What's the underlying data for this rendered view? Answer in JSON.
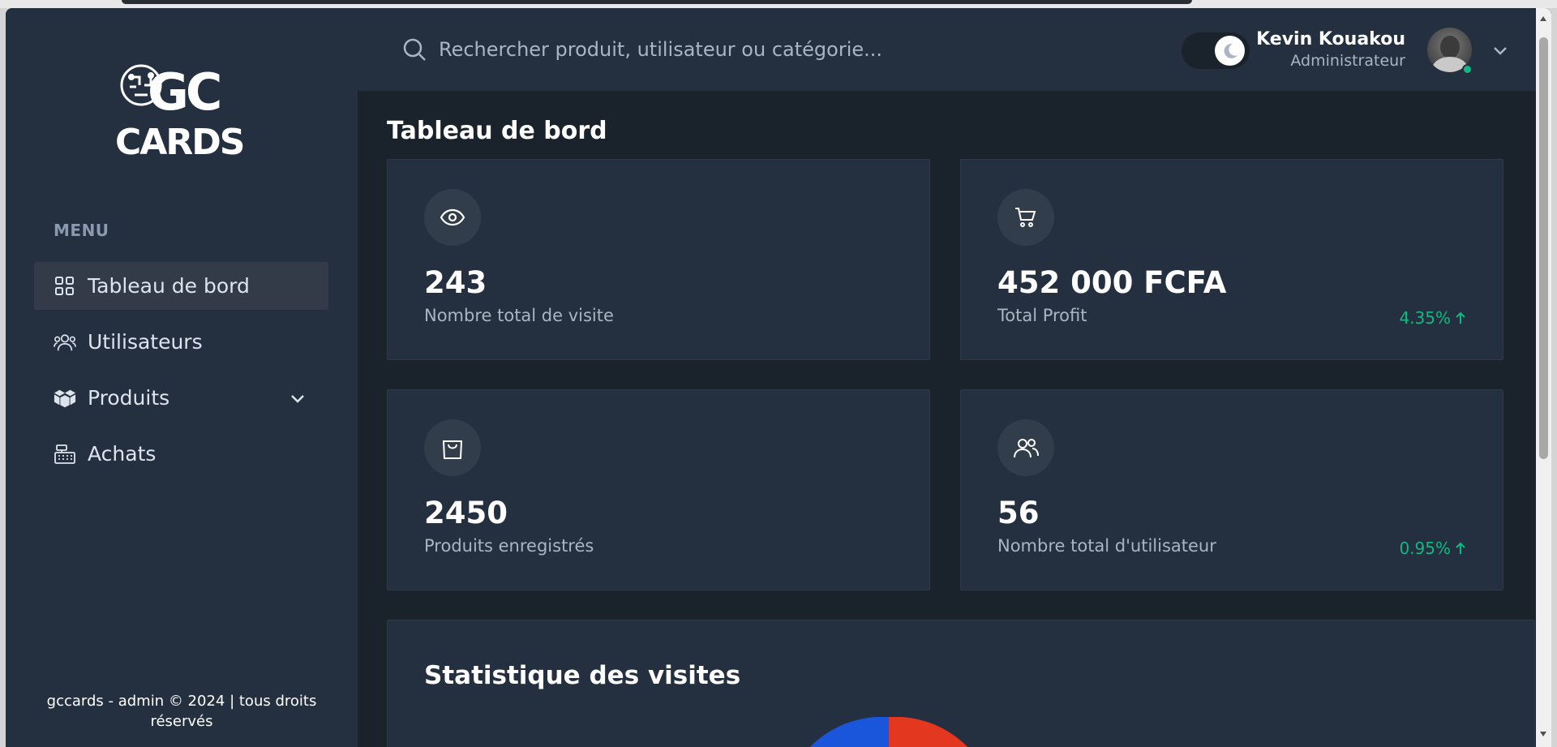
{
  "logo": {
    "top_text": "GC",
    "bottom_text": "CARDS"
  },
  "sidebar": {
    "menu_heading": "MENU",
    "items": [
      {
        "label": "Tableau de bord",
        "icon": "grid-icon",
        "active": true
      },
      {
        "label": "Utilisateurs",
        "icon": "users-icon",
        "active": false
      },
      {
        "label": "Produits",
        "icon": "boxes-icon",
        "active": false,
        "has_submenu": true
      },
      {
        "label": "Achats",
        "icon": "cash-register-icon",
        "active": false
      }
    ],
    "footer": "gccards - admin © 2024 | tous droits réservés"
  },
  "header": {
    "search_placeholder": "Rechercher produit, utilisateur ou catégorie...",
    "theme": "dark",
    "user": {
      "name": "Kevin Kouakou",
      "role": "Administrateur",
      "online": true
    }
  },
  "main": {
    "title": "Tableau de bord",
    "cards": [
      {
        "value": "243",
        "label": "Nombre total de visite",
        "icon": "eye-icon",
        "trend": ""
      },
      {
        "value": "452 000 FCFA",
        "label": "Total Profit",
        "icon": "cart-icon",
        "trend": "4.35%"
      },
      {
        "value": "2450",
        "label": "Produits enregistrés",
        "icon": "shopping-bag-icon",
        "trend": ""
      },
      {
        "value": "56",
        "label": "Nombre total d'utilisateur",
        "icon": "users-icon",
        "trend": "0.95%"
      }
    ],
    "stats": {
      "title": "Statistique des visites"
    }
  },
  "colors": {
    "sidebar_bg": "#24303f",
    "main_bg": "#1a222c",
    "trend_positive": "#10b981",
    "pie_blue": "#1a56db",
    "pie_red": "#e3381f"
  }
}
